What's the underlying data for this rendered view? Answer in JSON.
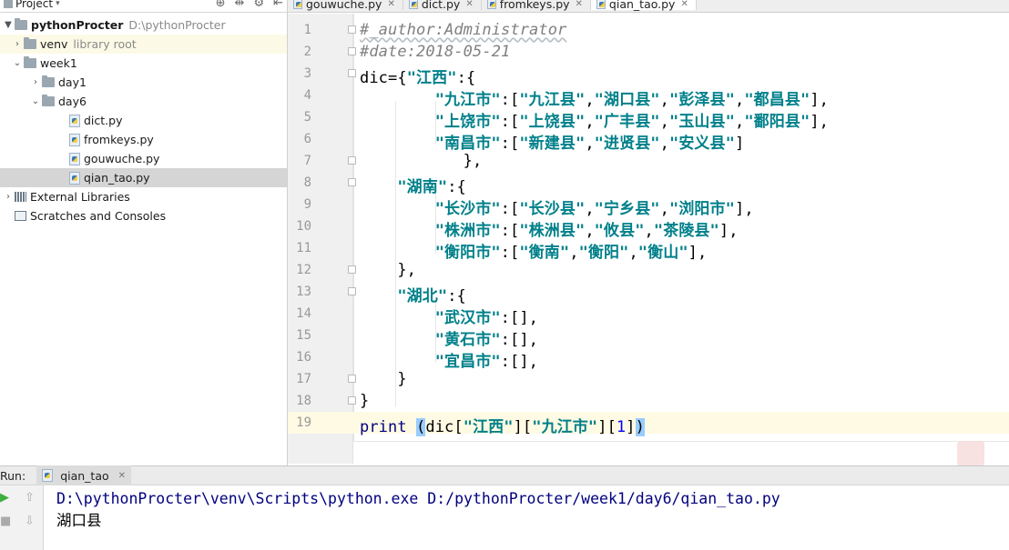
{
  "project_panel": {
    "title": "Project",
    "tools": [
      "⊕",
      "⇹",
      "⚙",
      "⇤"
    ],
    "tree": [
      {
        "label": "pythonProcter",
        "muted": "D:\\pythonProcter",
        "type": "root"
      },
      {
        "label": "venv",
        "muted": "library root",
        "type": "folder",
        "expanded": false
      },
      {
        "label": "week1",
        "type": "folder",
        "expanded": true
      },
      {
        "label": "day1",
        "type": "folder",
        "expanded": false
      },
      {
        "label": "day6",
        "type": "folder",
        "expanded": true
      },
      {
        "label": "dict.py",
        "type": "file"
      },
      {
        "label": "fromkeys.py",
        "type": "file"
      },
      {
        "label": "gouwuche.py",
        "type": "file"
      },
      {
        "label": "qian_tao.py",
        "type": "file",
        "selected": true
      },
      {
        "label": "External Libraries",
        "type": "lib"
      },
      {
        "label": "Scratches and Consoles",
        "type": "scratch"
      }
    ]
  },
  "tabs": [
    {
      "label": "gouwuche.py",
      "active": false
    },
    {
      "label": "dict.py",
      "active": false
    },
    {
      "label": "fromkeys.py",
      "active": false
    },
    {
      "label": "qian_tao.py",
      "active": true
    }
  ],
  "editor": {
    "line_numbers": [
      "1",
      "2",
      "3",
      "4",
      "5",
      "6",
      "7",
      "8",
      "9",
      "10",
      "11",
      "12",
      "13",
      "14",
      "15",
      "16",
      "17",
      "18",
      "19"
    ],
    "lines": [
      "#_author:Administrator",
      "#date:2018-05-21",
      "dic={\"江西\":{",
      "        \"九江市\":[\"九江县\",\"湖口县\",\"彭泽县\",\"都昌县\"],",
      "        \"上饶市\":[\"上饶县\",\"广丰县\",\"玉山县\",\"鄱阳县\"],",
      "        \"南昌市\":[\"新建县\",\"进贤县\",\"安义县\"]",
      "           },",
      "    \"湖南\":{",
      "        \"长沙市\":[\"长沙县\",\"宁乡县\",\"浏阳市\"],",
      "        \"株洲市\":[\"株洲县\",\"攸县\",\"茶陵县\"],",
      "        \"衡阳市\":[\"衡南\",\"衡阳\",\"衡山\"],",
      "    },",
      "    \"湖北\":{",
      "        \"武汉市\":[],",
      "        \"黄石市\":[],",
      "        \"宜昌市\":[],",
      "    }",
      "}",
      "print (dic[\"江西\"][\"九江市\"][1])"
    ],
    "current_line": 19
  },
  "run_panel": {
    "label": "Run:",
    "tab_label": "qian_tao",
    "command": "D:\\pythonProcter\\venv\\Scripts\\python.exe D:/pythonProcter/week1/day6/qian_tao.py",
    "output": "湖口县"
  },
  "colors": {
    "string": "#00808a",
    "comment": "#808080",
    "keyword": "#000080",
    "number": "#0000ff",
    "current_line": "#fffae3",
    "selected_row": "#d5d5d5"
  }
}
